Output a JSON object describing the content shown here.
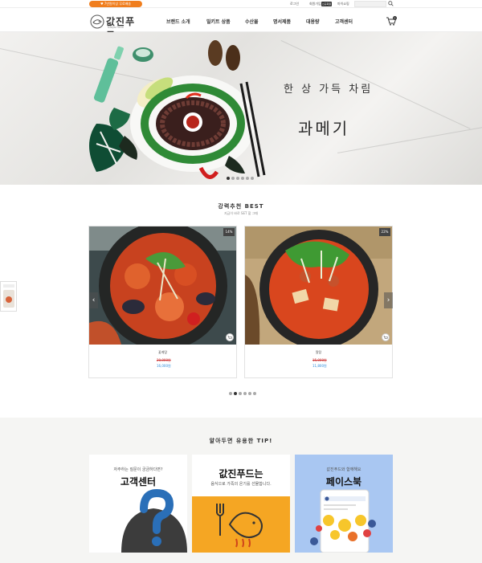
{
  "topbar": {
    "promo": "♥ 7만원이상 무료배송",
    "login": "로그인",
    "join": "회원가입",
    "badge": "신규회원",
    "mypage": "마이쇼핑"
  },
  "header": {
    "logo_text": "값진푸드",
    "logo_sub": "GAPJIN FOOD",
    "nav": [
      "브랜드 소개",
      "밀키트 상품",
      "수산물",
      "명서제품",
      "대용량",
      "고객센터"
    ],
    "cart_count": "0"
  },
  "hero": {
    "title": "한 상 가득 차림",
    "product": "과메기",
    "slide_count": 6,
    "active_slide": 1
  },
  "best": {
    "title": "강력추천 BEST",
    "subtitle": "지금이 바로 SET 할 그때",
    "products": [
      {
        "name": "꽃게탕",
        "old_price": "20,000원",
        "price": "16,000원",
        "tag": "14%"
      },
      {
        "name": "알탕",
        "old_price": "15,000원",
        "price": "11,800원",
        "tag": "22%"
      }
    ],
    "arrow_prev": "‹",
    "arrow_next": "›",
    "page_count": 6,
    "active_page": 2
  },
  "tips": {
    "title": "알아두면 유용한 TIP!",
    "cards": [
      {
        "small": "자주하는 질문이 궁금하다면?",
        "big": "고객센터"
      },
      {
        "big": "값진푸드는",
        "small": "음식으로 가족의 온기를 선물합니다."
      },
      {
        "small": "값진푸드와 함께해요",
        "big": "페이스북"
      }
    ]
  },
  "colors": {
    "promo": "#f07e1e",
    "tip_orange": "#f5a623",
    "tip_blue": "#a9c7f2",
    "price_blue": "#2b8ad9",
    "price_red": "#cc3333"
  }
}
